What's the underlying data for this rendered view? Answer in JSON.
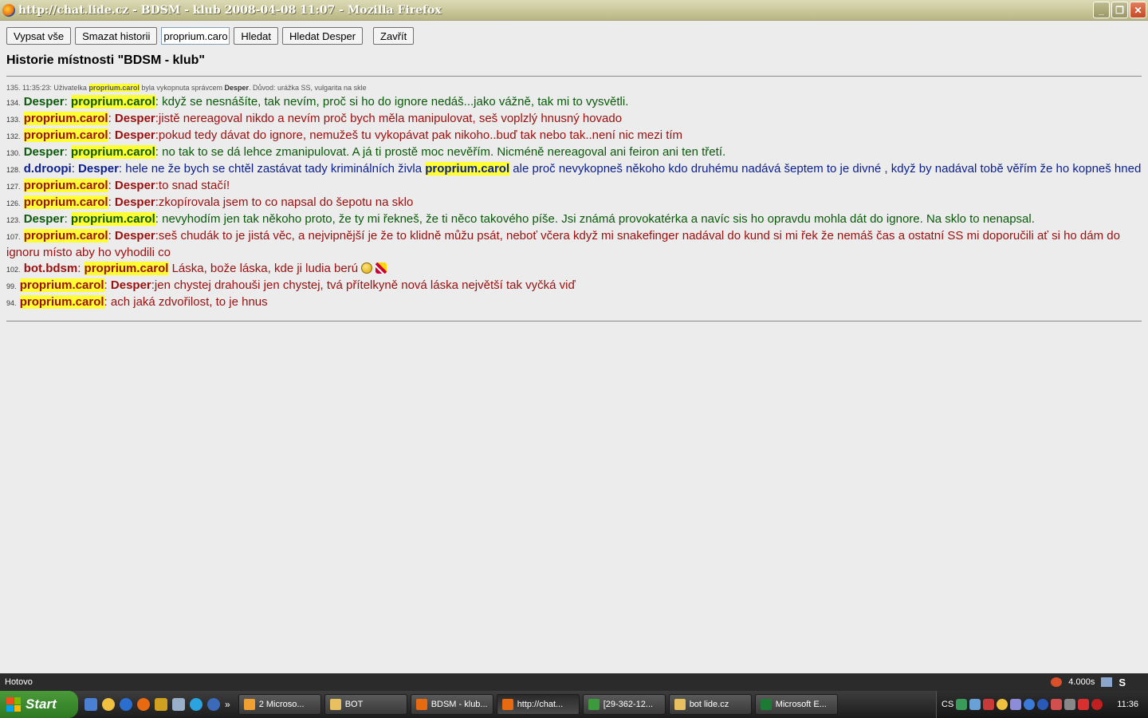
{
  "window": {
    "title": "http://chat.lide.cz - BDSM - klub 2008-04-08 11:07 - Mozilla Firefox",
    "minimize": "_",
    "maximize": "❐",
    "close": "✕"
  },
  "toolbar": {
    "list_all": "Vypsat vše",
    "clear_history": "Smazat historii",
    "search_value": "proprium.caro",
    "search": "Hledat",
    "search_user": "Hledat Desper",
    "close": "Zavřít"
  },
  "heading": "Historie místnosti \"BDSM - klub\"",
  "system_message": {
    "prefix": "135. 11:35:23: Uživatelka ",
    "user": "proprium.carol",
    "middle": " byla vykopnuta správcem ",
    "admin": "Desper",
    "suffix": ". Důvod: urážka SS, vulgarita na skle"
  },
  "messages": [
    {
      "num": "134.",
      "from": "Desper",
      "to": "proprium.carol",
      "text": ": když se nesnášíte, tak nevím, proč si ho do ignore nedáš...jako vážně, tak mi to vysvětli.",
      "color": "#0a5a0a"
    },
    {
      "num": "133.",
      "from": "proprium.carol",
      "to": "Desper",
      "text": ":jistě nereagoval nikdo a nevím proč bych měla manipulovat, seš voplzlý hnusný hovado",
      "color": "#9b0f0f"
    },
    {
      "num": "132.",
      "from": "proprium.carol",
      "to": "Desper",
      "text": ":pokud tedy dávat do ignore, nemužeš tu vykopávat pak nikoho..buď tak nebo tak..není nic mezi tím",
      "color": "#9b0f0f"
    },
    {
      "num": "130.",
      "from": "Desper",
      "to": "proprium.carol",
      "text": ": no tak to se dá lehce zmanipulovat. A já ti prostě moc nevěřím. Nicméně nereagoval ani feiron ani ten třetí.",
      "color": "#0a5a0a"
    },
    {
      "num": "128.",
      "from": "d.droopi",
      "to": "Desper",
      "text": ": hele ne že bych se chtěl zastávat tady kriminálních živla ",
      "mention": "proprium.carol",
      "text2": " ale proč nevykopneš někoho kdo druhému nadává šeptem to je divné , když by nadával tobě věřím že ho kopneš hned",
      "color": "#0b1f8f"
    },
    {
      "num": "127.",
      "from": "proprium.carol",
      "to": "Desper",
      "text": ":to snad stačí!",
      "color": "#9b0f0f"
    },
    {
      "num": "126.",
      "from": "proprium.carol",
      "to": "Desper",
      "text": ":zkopírovala jsem to co napsal do šepotu na sklo",
      "color": "#9b0f0f"
    },
    {
      "num": "123.",
      "from": "Desper",
      "to": "proprium.carol",
      "text": ": nevyhodím jen tak někoho proto, že ty mi řekneš, že ti něco takového píše. Jsi známá provokatérka a navíc sis ho opravdu mohla dát do ignore. Na sklo to nenapsal.",
      "color": "#0a5a0a"
    },
    {
      "num": "107.",
      "from": "proprium.carol",
      "to": "Desper",
      "text": ":seš chudák to je jistá věc, a nejvipnější je že to klidně můžu psát, neboť včera když mi snakefinger nadával do kund si mi řek že nemáš čas a ostatní SS mi doporučili ať si ho dám do ignoru místo aby ho vyhodili co",
      "color": "#9b0f0f"
    },
    {
      "num": "102.",
      "from": "bot.bdsm",
      "to": "proprium.carol",
      "text": " Láska, bože láska, kde ji ludia berú ",
      "color": "#9b0f0f"
    },
    {
      "num": "99.",
      "from": "proprium.carol",
      "to": "Desper",
      "text": ":jen chystej drahouši jen chystej, tvá přítelkyně nová láska největší tak vyčká viď",
      "color": "#9b0f0f"
    },
    {
      "num": "94.",
      "from": "proprium.carol",
      "text": ": ach jaká zdvořilost, to je hnus",
      "color": "#9b0f0f"
    }
  ],
  "statusbar": {
    "status": "Hotovo",
    "timing": "4.000s",
    "s_label": "S"
  },
  "taskbar": {
    "start": "Start",
    "chevron": "»",
    "tasks": [
      {
        "label": "2 Microso...",
        "icon_color": "#f0a030"
      },
      {
        "label": "BOT",
        "icon_color": "#e8c060"
      },
      {
        "label": "BDSM - klub...",
        "icon_color": "#e86a10"
      },
      {
        "label": "http://chat...",
        "icon_color": "#e86a10",
        "active": true
      },
      {
        "label": "[29-362-12...",
        "icon_color": "#3c9a3c"
      },
      {
        "label": "bot lide.cz",
        "icon_color": "#e8c060"
      },
      {
        "label": "Microsoft E...",
        "icon_color": "#1d7a35"
      }
    ],
    "lang": "CS",
    "clock": "11:36"
  }
}
